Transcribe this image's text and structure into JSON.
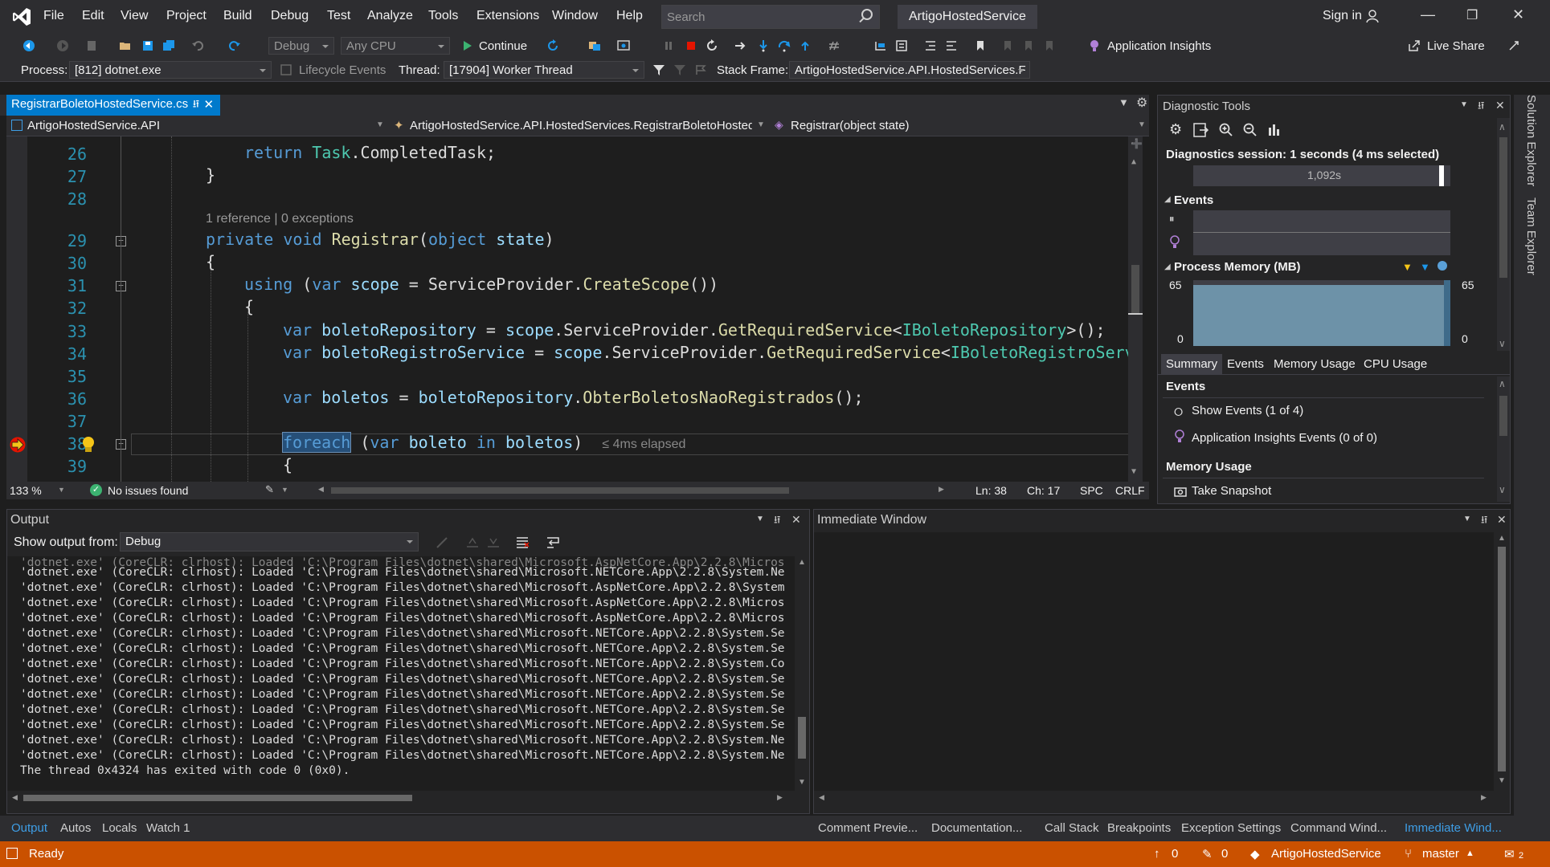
{
  "menu": {
    "items": [
      "File",
      "Edit",
      "View",
      "Project",
      "Build",
      "Debug",
      "Test",
      "Analyze",
      "Tools",
      "Extensions",
      "Window",
      "Help"
    ],
    "search_placeholder": "Search",
    "solution_title": "ArtigoHostedService",
    "sign_in": "Sign in"
  },
  "toolbar": {
    "config": "Debug",
    "platform": "Any CPU",
    "continue_label": "Continue",
    "app_insights": "Application Insights",
    "live_share": "Live Share"
  },
  "debug_bar": {
    "process_label": "Process:",
    "process_value": "[812] dotnet.exe",
    "lifecycle": "Lifecycle Events",
    "thread_label": "Thread:",
    "thread_value": "[17904] Worker Thread",
    "stack_label": "Stack Frame:",
    "stack_value": "ArtigoHostedService.API.HostedServices.F"
  },
  "editor": {
    "tab_name": "RegistrarBoletoHostedService.cs",
    "nav_project": "ArtigoHostedService.API",
    "nav_class": "ArtigoHostedService.API.HostedServices.RegistrarBoletoHostedS",
    "nav_member": "Registrar(object state)",
    "codelens": "1 reference | 0 exceptions",
    "elapsed": "≤ 4ms elapsed",
    "line_numbers": [
      "26",
      "27",
      "28",
      "29",
      "30",
      "31",
      "32",
      "33",
      "34",
      "35",
      "36",
      "37",
      "38",
      "39"
    ],
    "zoom": "133 %",
    "issues": "No issues found",
    "ln": "Ln: 38",
    "ch": "Ch: 17",
    "spc": "SPC",
    "crlf": "CRLF"
  },
  "code": {
    "l26_kw": "return",
    "l26_ty": "Task",
    "l26_rest": ".CompletedTask;",
    "l27": "}",
    "l29_kw1": "private",
    "l29_kw2": "void",
    "l29_fn": "Registrar",
    "l29_kw3": "object",
    "l29_pa": "state",
    "l30": "{",
    "l31_kw": "using",
    "l31_kw2": "var",
    "l31_pa": "scope",
    "l31_fn1": "ServiceProvider",
    "l31_fn2": "CreateScope",
    "l32": "{",
    "l33_kw": "var",
    "l33_pa": "boletoRepository",
    "l33_pa2": "scope",
    "l33_pa3": "ServiceProvider",
    "l33_fn": "GetRequiredService",
    "l33_ty": "IBoletoRepository",
    "l34_kw": "var",
    "l34_pa": "boletoRegistroService",
    "l34_pa2": "scope",
    "l34_pa3": "ServiceProvider",
    "l34_fn": "GetRequiredService",
    "l34_ty": "IBoletoRegistroServ:",
    "l36_kw": "var",
    "l36_pa": "boletos",
    "l36_pa2": "boletoRepository",
    "l36_fn": "ObterBoletosNaoRegistrados",
    "l38_kw": "foreach",
    "l38_kw2": "var",
    "l38_pa": "boleto",
    "l38_kw3": "in",
    "l38_pa2": "boletos",
    "l39": "{"
  },
  "diagnostics": {
    "title": "Diagnostic Tools",
    "session": "Diagnostics session: 1 seconds (4 ms selected)",
    "timeline_label": "1,092s",
    "events_header": "Events",
    "memory_header": "Process Memory (MB)",
    "mem_max_left": "65",
    "mem_min_left": "0",
    "mem_max_right": "65",
    "mem_min_right": "0",
    "tabs": [
      "Summary",
      "Events",
      "Memory Usage",
      "CPU Usage"
    ],
    "events_section": "Events",
    "show_events": "Show Events (1 of 4)",
    "ai_events": "Application Insights Events (0 of 0)",
    "memory_section": "Memory Usage",
    "take_snapshot": "Take Snapshot"
  },
  "output": {
    "title": "Output",
    "show_from_label": "Show output from:",
    "show_from_value": "Debug",
    "lines": [
      "'dotnet.exe' (CoreCLR: clrhost): Loaded 'C:\\Program Files\\dotnet\\shared\\Microsoft.AspNetCore.App\\2.2.8\\Micros",
      "'dotnet.exe' (CoreCLR: clrhost): Loaded 'C:\\Program Files\\dotnet\\shared\\Microsoft.NETCore.App\\2.2.8\\System.Ne",
      "'dotnet.exe' (CoreCLR: clrhost): Loaded 'C:\\Program Files\\dotnet\\shared\\Microsoft.AspNetCore.App\\2.2.8\\System",
      "'dotnet.exe' (CoreCLR: clrhost): Loaded 'C:\\Program Files\\dotnet\\shared\\Microsoft.AspNetCore.App\\2.2.8\\Micros",
      "'dotnet.exe' (CoreCLR: clrhost): Loaded 'C:\\Program Files\\dotnet\\shared\\Microsoft.AspNetCore.App\\2.2.8\\Micros",
      "'dotnet.exe' (CoreCLR: clrhost): Loaded 'C:\\Program Files\\dotnet\\shared\\Microsoft.NETCore.App\\2.2.8\\System.Se",
      "'dotnet.exe' (CoreCLR: clrhost): Loaded 'C:\\Program Files\\dotnet\\shared\\Microsoft.NETCore.App\\2.2.8\\System.Se",
      "'dotnet.exe' (CoreCLR: clrhost): Loaded 'C:\\Program Files\\dotnet\\shared\\Microsoft.NETCore.App\\2.2.8\\System.Co",
      "'dotnet.exe' (CoreCLR: clrhost): Loaded 'C:\\Program Files\\dotnet\\shared\\Microsoft.NETCore.App\\2.2.8\\System.Se",
      "'dotnet.exe' (CoreCLR: clrhost): Loaded 'C:\\Program Files\\dotnet\\shared\\Microsoft.NETCore.App\\2.2.8\\System.Se",
      "'dotnet.exe' (CoreCLR: clrhost): Loaded 'C:\\Program Files\\dotnet\\shared\\Microsoft.NETCore.App\\2.2.8\\System.Se",
      "'dotnet.exe' (CoreCLR: clrhost): Loaded 'C:\\Program Files\\dotnet\\shared\\Microsoft.NETCore.App\\2.2.8\\System.Se",
      "'dotnet.exe' (CoreCLR: clrhost): Loaded 'C:\\Program Files\\dotnet\\shared\\Microsoft.NETCore.App\\2.2.8\\System.Ne",
      "'dotnet.exe' (CoreCLR: clrhost): Loaded 'C:\\Program Files\\dotnet\\shared\\Microsoft.NETCore.App\\2.2.8\\System.Ne",
      "The thread 0x4324 has exited with code 0 (0x0)."
    ]
  },
  "immediate": {
    "title": "Immediate Window"
  },
  "bottom_tabs_left": [
    "Output",
    "Autos",
    "Locals",
    "Watch 1"
  ],
  "bottom_tabs_right": [
    "Comment Previe...",
    "Documentation...",
    "Call Stack",
    "Breakpoints",
    "Exception Settings",
    "Command Wind...",
    "Immediate Wind..."
  ],
  "side_tabs": [
    "Solution Explorer",
    "Team Explorer"
  ],
  "status": {
    "ready": "Ready",
    "up_count": "0",
    "edit_count": "0",
    "repo": "ArtigoHostedService",
    "branch": "master",
    "notif": "2"
  },
  "colors": {
    "accent": "#007acc",
    "status": "#ca5100",
    "breakpoint": "#e51400"
  }
}
